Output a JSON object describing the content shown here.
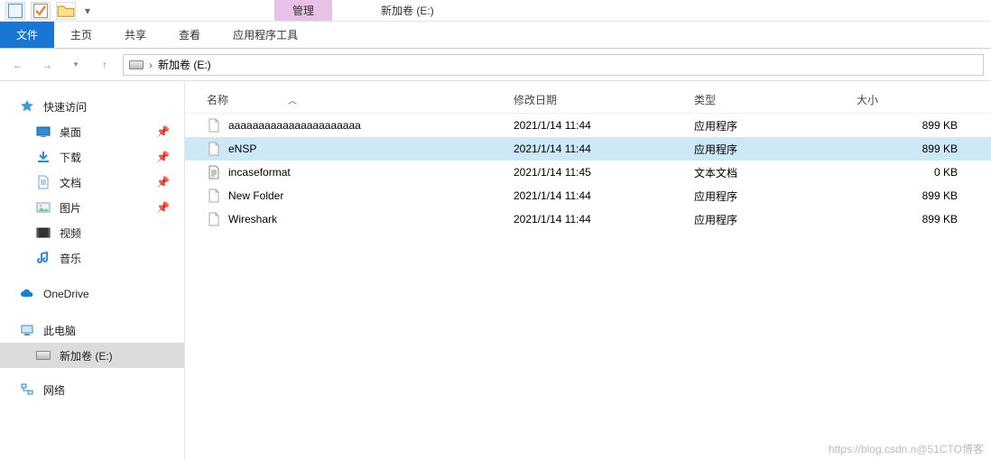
{
  "titlebar": {
    "context_tab": "管理",
    "window_title": "新加卷 (E:)"
  },
  "ribbon": {
    "file": "文件",
    "home": "主页",
    "share": "共享",
    "view": "查看",
    "tools": "应用程序工具"
  },
  "breadcrumb": {
    "location": "新加卷 (E:)"
  },
  "sidebar": {
    "quick_access": "快速访问",
    "desktop": "桌面",
    "downloads": "下载",
    "documents": "文档",
    "pictures": "图片",
    "videos": "视频",
    "music": "音乐",
    "onedrive": "OneDrive",
    "this_pc": "此电脑",
    "drive_e": "新加卷 (E:)",
    "network": "网络"
  },
  "columns": {
    "name": "名称",
    "modified": "修改日期",
    "type": "类型",
    "size": "大小"
  },
  "files": [
    {
      "name": "aaaaaaaaaaaaaaaaaaaaaa",
      "modified": "2021/1/14 11:44",
      "type": "应用程序",
      "size": "899 KB",
      "icon": "file",
      "selected": false
    },
    {
      "name": "eNSP",
      "modified": "2021/1/14 11:44",
      "type": "应用程序",
      "size": "899 KB",
      "icon": "file",
      "selected": true
    },
    {
      "name": "incaseformat",
      "modified": "2021/1/14 11:45",
      "type": "文本文档",
      "size": "0 KB",
      "icon": "txt",
      "selected": false
    },
    {
      "name": "New Folder",
      "modified": "2021/1/14 11:44",
      "type": "应用程序",
      "size": "899 KB",
      "icon": "file",
      "selected": false
    },
    {
      "name": "Wireshark",
      "modified": "2021/1/14 11:44",
      "type": "应用程序",
      "size": "899 KB",
      "icon": "file",
      "selected": false
    }
  ],
  "watermark": "https://blog.csdn.n@51CTO博客"
}
